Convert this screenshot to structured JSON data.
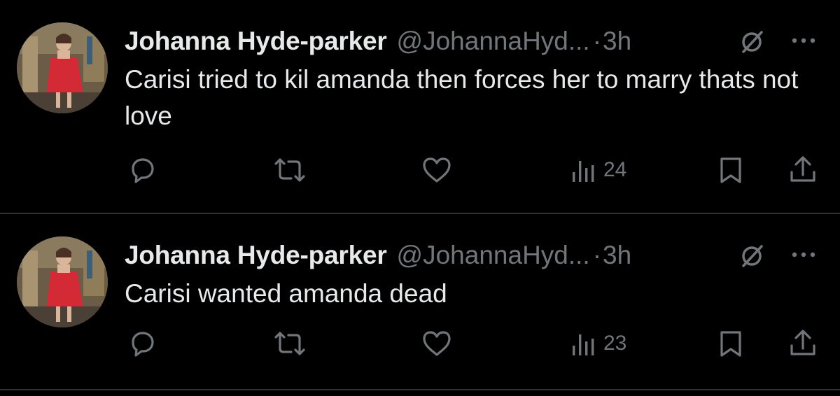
{
  "tweets": [
    {
      "author": {
        "display_name": "Johanna Hyde-parker",
        "handle": "@JohannaHyd...",
        "avatar_icon": "profile-photo"
      },
      "separator": "·",
      "time": "3h",
      "text": "Carisi tried to kil amanda then forces her to marry thats not love",
      "views": "24"
    },
    {
      "author": {
        "display_name": "Johanna Hyde-parker",
        "handle": "@JohannaHyd...",
        "avatar_icon": "profile-photo"
      },
      "separator": "·",
      "time": "3h",
      "text": "Carisi wanted amanda dead",
      "views": "23"
    }
  ],
  "icons": {
    "grok": "grok-icon",
    "more": "more-icon",
    "reply": "reply-icon",
    "repost": "repost-icon",
    "like": "like-icon",
    "views": "views-icon",
    "bookmark": "bookmark-icon",
    "share": "share-icon"
  },
  "colors": {
    "background": "#000000",
    "primary_text": "#e7e9ea",
    "secondary_text": "#71767b",
    "divider": "#2f3336"
  }
}
